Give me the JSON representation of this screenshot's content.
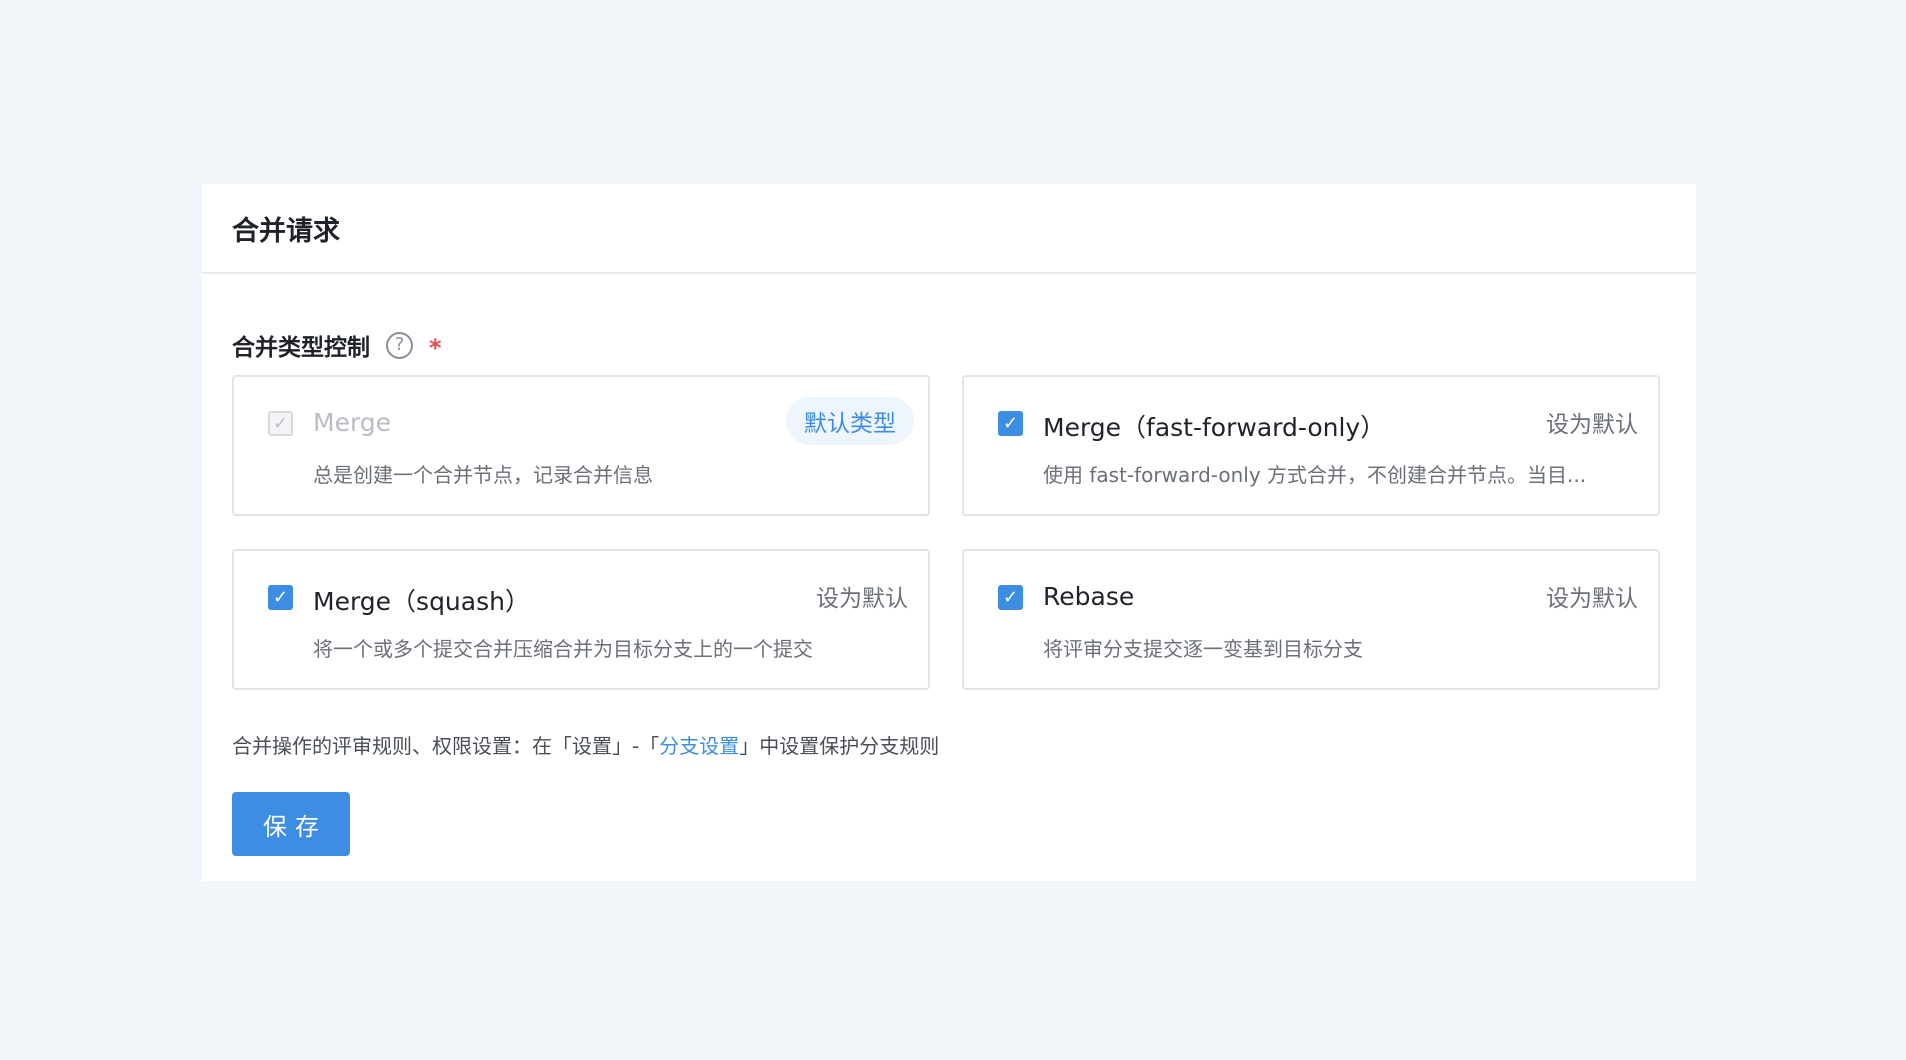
{
  "panel": {
    "title": "合并请求"
  },
  "section": {
    "label": "合并类型控制",
    "help_icon": "?",
    "required_mark": "*"
  },
  "cards": [
    {
      "title": "Merge",
      "description": "总是创建一个合并节点，记录合并信息",
      "checked": true,
      "disabled": true,
      "badge": "默认类型"
    },
    {
      "title": "Merge（fast-forward-only）",
      "description": "使用 fast-forward-only 方式合并，不创建合并节点。当目...",
      "checked": true,
      "disabled": false,
      "action": "设为默认"
    },
    {
      "title": "Merge（squash）",
      "description": "将一个或多个提交合并压缩合并为目标分支上的一个提交",
      "checked": true,
      "disabled": false,
      "action": "设为默认"
    },
    {
      "title": "Rebase",
      "description": "将评审分支提交逐一变基到目标分支",
      "checked": true,
      "disabled": false,
      "action": "设为默认"
    }
  ],
  "hint": {
    "prefix": "合并操作的评审规则、权限设置：在「设置」-「",
    "link": "分支设置",
    "suffix": "」中设置保护分支规则"
  },
  "save_button": "保存",
  "checkmark": "✓",
  "colors": {
    "accent": "#3d8ee3",
    "background": "#f2f6fa",
    "required": "#e5484d"
  }
}
